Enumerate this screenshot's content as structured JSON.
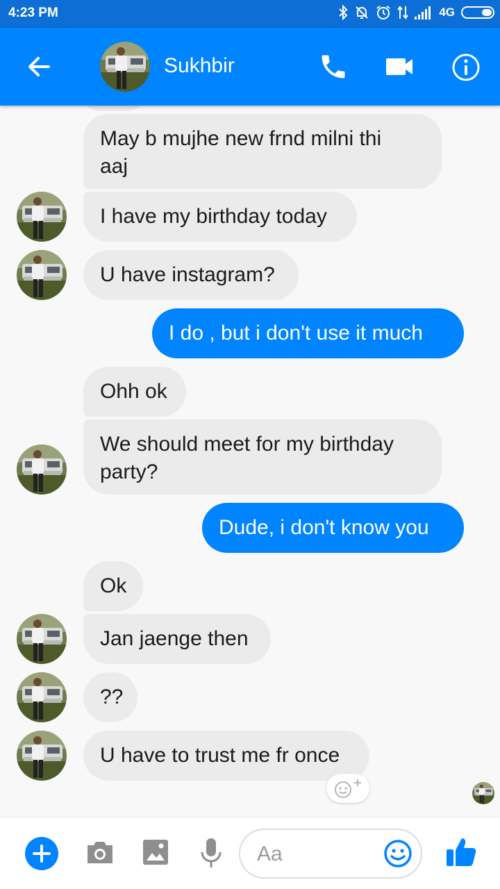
{
  "status_bar": {
    "time": "4:23 PM",
    "network": "4G"
  },
  "header": {
    "contact_name": "Sukhbir",
    "icons": [
      "back-arrow-icon",
      "phone-icon",
      "video-camera-icon",
      "info-icon"
    ]
  },
  "messages": [
    {
      "direction": "received",
      "text_lines": [
        "May b mujhe new frnd milni thi",
        "aaj"
      ],
      "avatar": false
    },
    {
      "direction": "received",
      "text_lines": [
        "I have my birthday today"
      ],
      "avatar": true
    },
    {
      "direction": "received",
      "text_lines": [
        "U have instagram?"
      ],
      "avatar": true
    },
    {
      "direction": "sent",
      "text_lines": [
        "I do ,  but i don't  use it much"
      ]
    },
    {
      "direction": "received",
      "text_lines": [
        "Ohh ok"
      ],
      "avatar": false
    },
    {
      "direction": "received",
      "text_lines": [
        "We should meet for my birthday",
        "party?"
      ],
      "avatar": true
    },
    {
      "direction": "sent",
      "text_lines": [
        "Dude,  i don't  know you"
      ]
    },
    {
      "direction": "received",
      "text_lines": [
        "Ok"
      ],
      "avatar": false
    },
    {
      "direction": "received",
      "text_lines": [
        "Jan jaenge then"
      ],
      "avatar": true
    },
    {
      "direction": "received",
      "text_lines": [
        "??"
      ],
      "avatar": true
    },
    {
      "direction": "received",
      "text_lines": [
        "U have to trust me fr once"
      ],
      "avatar": true
    }
  ],
  "composer": {
    "placeholder": "Aa",
    "icons": [
      "plus-icon",
      "camera-icon",
      "gallery-icon",
      "microphone-icon",
      "emoji-icon",
      "thumbs-up-icon"
    ]
  },
  "colors": {
    "status_bar": "#0d6fd6",
    "header": "#0084ff",
    "sent_bubble": "#0084ff",
    "received_bubble": "#ebebeb",
    "background": "#f8f8f8"
  }
}
